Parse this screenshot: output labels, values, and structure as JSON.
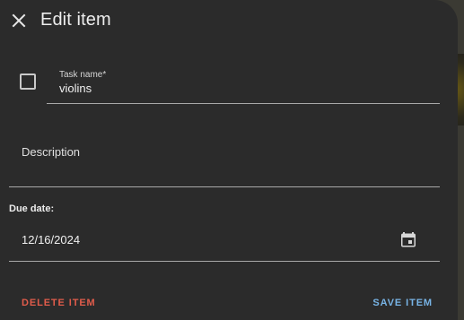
{
  "dialog": {
    "title": "Edit item",
    "close_icon": "close-icon"
  },
  "task": {
    "completed": false,
    "label": "Task name*",
    "value": "violins"
  },
  "description": {
    "placeholder": "Description",
    "value": ""
  },
  "due_date": {
    "label": "Due date:",
    "value": "12/16/2024",
    "icon": "calendar-icon"
  },
  "actions": {
    "delete_label": "DELETE ITEM",
    "save_label": "SAVE ITEM"
  },
  "colors": {
    "surface": "#2b2b2b",
    "delete": "#e15c4b",
    "save": "#78b4e6"
  }
}
